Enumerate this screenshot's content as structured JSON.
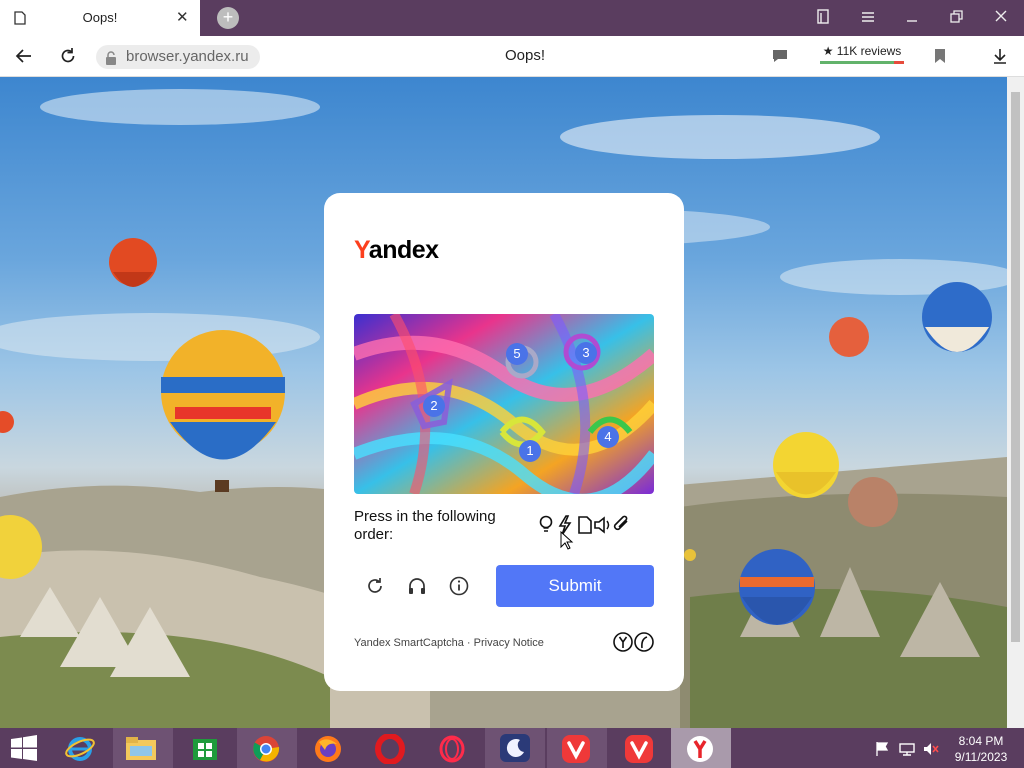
{
  "tab": {
    "title": "Oops!"
  },
  "address": {
    "url": "browser.yandex.ru",
    "page_title": "Oops!",
    "reviews": "★ 11K reviews"
  },
  "captcha": {
    "logo_y": "Y",
    "logo_rest": "andex",
    "prompt": "Press in the following order:",
    "numbers": [
      "1",
      "2",
      "3",
      "4",
      "5"
    ],
    "order_icons": [
      "lightbulb-icon",
      "lightning-icon",
      "document-icon",
      "speaker-icon",
      "paperclip-icon"
    ],
    "submit": "Submit",
    "footer": "Yandex SmartCaptcha · Privacy Notice"
  },
  "taskbar": {
    "apps": [
      "start-icon",
      "internet-explorer-icon",
      "file-explorer-icon",
      "store-icon",
      "chrome-icon",
      "firefox-icon",
      "opera-icon",
      "opera-gx-icon",
      "night-app-icon",
      "vivaldi-icon",
      "vivaldi-icon",
      "yandex-browser-icon"
    ],
    "time": "8:04 PM",
    "date": "9/11/2023"
  },
  "colors": {
    "accent": "#5277f7",
    "titlebar": "#5a3d5f",
    "yandex_red": "#fc3f1d"
  }
}
